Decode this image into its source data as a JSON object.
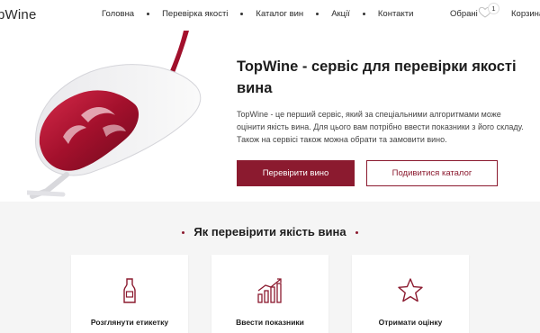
{
  "header": {
    "logo": "pWine",
    "nav": [
      "Головна",
      "Перевірка якості",
      "Каталог вин",
      "Акції",
      "Контакти"
    ],
    "favorites_label": "Обрані",
    "favorites_count": "1",
    "cart_label": "Корзина"
  },
  "hero": {
    "title": "TopWine - сервіс для перевірки якості вина",
    "description": "TopWine - це перший сервіс, який за спеціальними алгоритмами може оцінити якість вина. Для цього вам потрібно ввести показники з його складу. Також на сервісі також можна обрати та замовити вино.",
    "primary_button": "Перевірити вино",
    "secondary_button": "Подивитися каталог"
  },
  "how": {
    "title": "Як перевірити якість вина",
    "cards": [
      {
        "label": "Розглянути етикетку",
        "icon": "bottle-icon"
      },
      {
        "label": "Ввести показники",
        "icon": "bar-chart-icon"
      },
      {
        "label": "Отримати оцінку",
        "icon": "star-icon"
      }
    ]
  },
  "colors": {
    "accent": "#8b1a2f",
    "section_bg": "#f5f5f5"
  }
}
